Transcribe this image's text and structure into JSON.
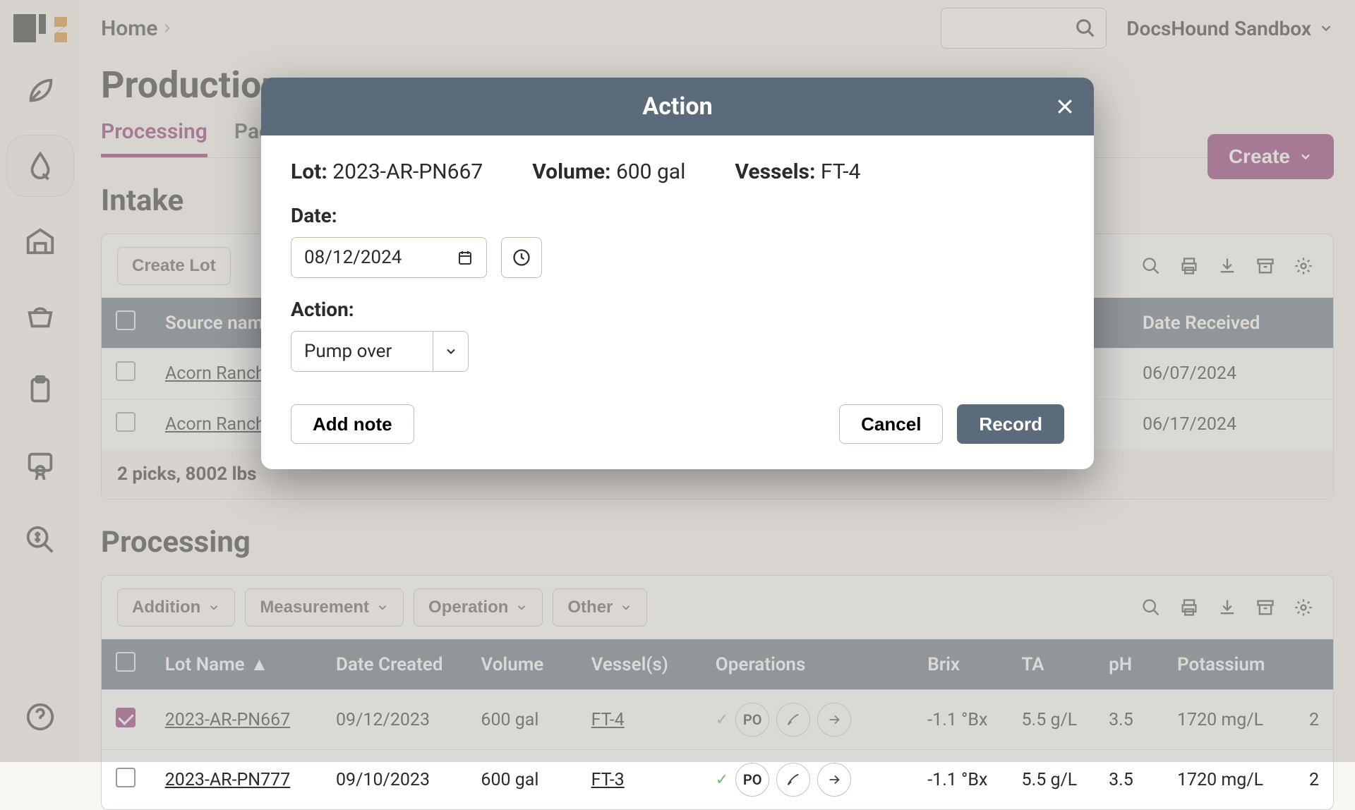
{
  "workspace": {
    "name": "DocsHound Sandbox"
  },
  "breadcrumb": {
    "home": "Home"
  },
  "page": {
    "title": "Production"
  },
  "tabs": {
    "processing": "Processing",
    "packaging": "Packaging"
  },
  "create_button": "Create",
  "sections": {
    "intake": "Intake",
    "processing": "Processing"
  },
  "intake": {
    "create_lot": "Create Lot",
    "columns": {
      "source": "Source name",
      "date_received": "Date Received"
    },
    "rows": [
      {
        "source": "Acorn Ranch",
        "date_received": "06/07/2024"
      },
      {
        "source": "Acorn Ranch",
        "date_received": "06/17/2024"
      }
    ],
    "footer": "2 picks, 8002 lbs"
  },
  "processing": {
    "filters": {
      "addition": "Addition",
      "measurement": "Measurement",
      "operation": "Operation",
      "other": "Other"
    },
    "columns": {
      "lot_name": "Lot Name",
      "date_created": "Date Created",
      "volume": "Volume",
      "vessels": "Vessel(s)",
      "operations": "Operations",
      "brix": "Brix",
      "ta": "TA",
      "ph": "pH",
      "potassium": "Potassium"
    },
    "rows": [
      {
        "checked": true,
        "lot": "2023-AR-PN667",
        "date": "09/12/2023",
        "volume": "600 gal",
        "vessel": "FT-4",
        "op_code": "PO",
        "brix": "-1.1 °Bx",
        "ta": "5.5 g/L",
        "ph": "3.5",
        "potassium": "1720 mg/L"
      },
      {
        "checked": false,
        "lot": "2023-AR-PN777",
        "date": "09/10/2023",
        "volume": "600 gal",
        "vessel": "FT-3",
        "op_code": "PO",
        "brix": "-1.1 °Bx",
        "ta": "5.5 g/L",
        "ph": "3.5",
        "potassium": "1720 mg/L"
      }
    ],
    "trailing_col_char": "2"
  },
  "modal": {
    "title": "Action",
    "lot_label": "Lot:",
    "lot_value": "2023-AR-PN667",
    "volume_label": "Volume:",
    "volume_value": "600 gal",
    "vessels_label": "Vessels:",
    "vessels_value": "FT-4",
    "date_label": "Date:",
    "date_value": "08/12/2024",
    "action_label": "Action:",
    "action_value": "Pump over",
    "add_note": "Add note",
    "cancel": "Cancel",
    "record": "Record"
  },
  "colors": {
    "accent": "#8b2a6f",
    "header": "#5b6b7a"
  }
}
